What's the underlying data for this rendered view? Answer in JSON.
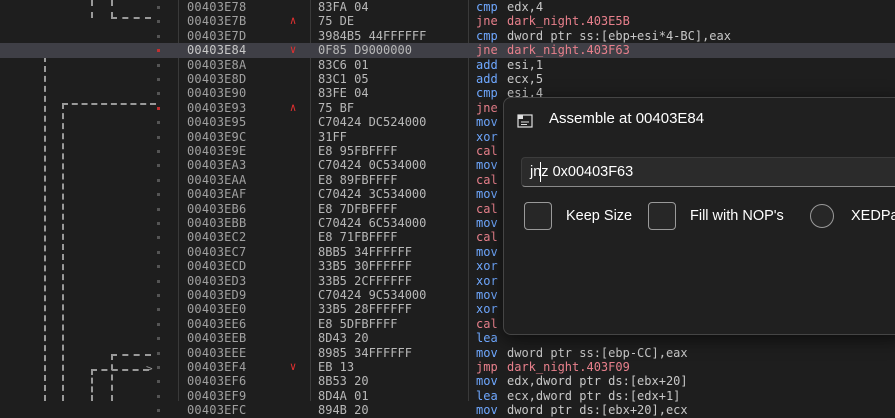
{
  "disassembly": {
    "rows": [
      {
        "addr": "00403E78",
        "bytes": "83FA 04",
        "mnem": "cmp",
        "ops": "edx,4",
        "arrow": "",
        "dot": "",
        "selected": false
      },
      {
        "addr": "00403E7B",
        "bytes": "75 DE",
        "mnem": "jne",
        "ops": "dark_night.403E5B",
        "arrow": "up",
        "dot": "",
        "selected": false,
        "jump": true
      },
      {
        "addr": "00403E7D",
        "bytes": "3984B5 44FFFFFF",
        "mnem": "cmp",
        "ops": "dword ptr ss:[ebp+esi*4-BC],eax",
        "arrow": "",
        "dot": "",
        "selected": false
      },
      {
        "addr": "00403E84",
        "bytes": "0F85 D9000000",
        "mnem": "jne",
        "ops": "dark_night.403F63",
        "arrow": "down",
        "dot": "red",
        "selected": true,
        "jump": true
      },
      {
        "addr": "00403E8A",
        "bytes": "83C6 01",
        "mnem": "add",
        "ops": "esi,1",
        "arrow": "",
        "dot": "",
        "selected": false
      },
      {
        "addr": "00403E8D",
        "bytes": "83C1 05",
        "mnem": "add",
        "ops": "ecx,5",
        "arrow": "",
        "dot": "",
        "selected": false
      },
      {
        "addr": "00403E90",
        "bytes": "83FE 04",
        "mnem": "cmp",
        "ops": "esi,4",
        "arrow": "",
        "dot": "",
        "selected": false
      },
      {
        "addr": "00403E93",
        "bytes": "75 BF",
        "mnem": "jne",
        "ops": "",
        "arrow": "up",
        "dot": "red",
        "selected": false,
        "jump": true
      },
      {
        "addr": "00403E95",
        "bytes": "C70424 DC524000",
        "mnem": "mov",
        "ops": "",
        "arrow": "",
        "dot": "",
        "selected": false
      },
      {
        "addr": "00403E9C",
        "bytes": "31FF",
        "mnem": "xor",
        "ops": "",
        "arrow": "",
        "dot": "",
        "selected": false
      },
      {
        "addr": "00403E9E",
        "bytes": "E8 95FBFFFF",
        "mnem": "cal",
        "ops": "",
        "arrow": "",
        "dot": "",
        "selected": false,
        "jump": true
      },
      {
        "addr": "00403EA3",
        "bytes": "C70424 0C534000",
        "mnem": "mov",
        "ops": "",
        "arrow": "",
        "dot": "",
        "selected": false
      },
      {
        "addr": "00403EAA",
        "bytes": "E8 89FBFFFF",
        "mnem": "cal",
        "ops": "",
        "arrow": "",
        "dot": "",
        "selected": false,
        "jump": true
      },
      {
        "addr": "00403EAF",
        "bytes": "C70424 3C534000",
        "mnem": "mov",
        "ops": "",
        "arrow": "",
        "dot": "",
        "selected": false
      },
      {
        "addr": "00403EB6",
        "bytes": "E8 7DFBFFFF",
        "mnem": "cal",
        "ops": "",
        "arrow": "",
        "dot": "",
        "selected": false,
        "jump": true
      },
      {
        "addr": "00403EBB",
        "bytes": "C70424 6C534000",
        "mnem": "mov",
        "ops": "",
        "arrow": "",
        "dot": "",
        "selected": false
      },
      {
        "addr": "00403EC2",
        "bytes": "E8 71FBFFFF",
        "mnem": "cal",
        "ops": "",
        "arrow": "",
        "dot": "",
        "selected": false,
        "jump": true
      },
      {
        "addr": "00403EC7",
        "bytes": "8BB5 34FFFFFF",
        "mnem": "mov",
        "ops": "",
        "arrow": "",
        "dot": "",
        "selected": false
      },
      {
        "addr": "00403ECD",
        "bytes": "33B5 30FFFFFF",
        "mnem": "xor",
        "ops": "",
        "arrow": "",
        "dot": "",
        "selected": false
      },
      {
        "addr": "00403ED3",
        "bytes": "33B5 2CFFFFFF",
        "mnem": "xor",
        "ops": "",
        "arrow": "",
        "dot": "",
        "selected": false
      },
      {
        "addr": "00403ED9",
        "bytes": "C70424 9C534000",
        "mnem": "mov",
        "ops": "",
        "arrow": "",
        "dot": "",
        "selected": false
      },
      {
        "addr": "00403EE0",
        "bytes": "33B5 28FFFFFF",
        "mnem": "xor",
        "ops": "",
        "arrow": "",
        "dot": "",
        "selected": false
      },
      {
        "addr": "00403EE6",
        "bytes": "E8 5DFBFFFF",
        "mnem": "cal",
        "ops": "",
        "arrow": "",
        "dot": "",
        "selected": false,
        "jump": true
      },
      {
        "addr": "00403EEB",
        "bytes": "8D43 20",
        "mnem": "lea",
        "ops": "",
        "arrow": "",
        "dot": "",
        "selected": false
      },
      {
        "addr": "00403EEE",
        "bytes": "8985 34FFFFFF",
        "mnem": "mov",
        "ops": "dword ptr ss:[ebp-CC],eax",
        "arrow": "",
        "dot": "",
        "selected": false
      },
      {
        "addr": "00403EF4",
        "bytes": "EB 13",
        "mnem": "jmp",
        "ops": "dark_night.403F09",
        "arrow": "down",
        "dot": "",
        "selected": false,
        "jump": true
      },
      {
        "addr": "00403EF6",
        "bytes": "8B53 20",
        "mnem": "mov",
        "ops": "edx,dword ptr ds:[ebx+20]",
        "arrow": "",
        "dot": "",
        "selected": false
      },
      {
        "addr": "00403EF9",
        "bytes": "8D4A 01",
        "mnem": "lea",
        "ops": "ecx,dword ptr ds:[edx+1]",
        "arrow": "",
        "dot": "",
        "selected": false
      },
      {
        "addr": "00403EFC",
        "bytes": "894B 20",
        "mnem": "mov",
        "ops": "dword ptr ds:[ebx+20],ecx",
        "arrow": "",
        "dot": "",
        "selected": false
      }
    ]
  },
  "dialog": {
    "title": "Assemble at 00403E84",
    "input_value": "jnz 0x00403F63",
    "keep_size_label": "Keep Size",
    "fill_nops_label": "Fill with NOP's",
    "xed_label": "XEDParse"
  },
  "colors": {
    "background": "#1e1e1e",
    "selected_row": "#3f3f46",
    "address": "#a0a0a0",
    "mnemonic": "#6fa8ff",
    "jump_target": "#e8808c",
    "arrow": "#e03030"
  }
}
